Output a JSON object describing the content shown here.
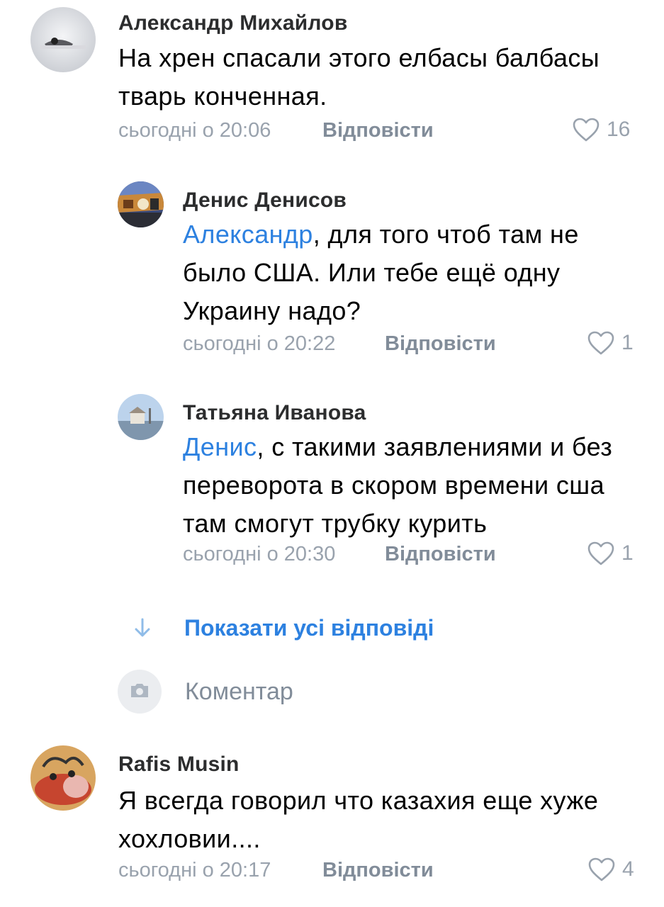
{
  "comments": [
    {
      "author": "Александр Михайлов",
      "text": "На хрен спасали этого елбасы балбасы тварь конченная.",
      "time": "сьогодні о 20:06",
      "reply_label": "Відповісти",
      "likes": "16"
    },
    {
      "author": "Денис Денисов",
      "mention": "Александр",
      "text": ", для того чтоб там не было США. Или тебе ещё одну Украину надо?",
      "time": "сьогодні о 20:22",
      "reply_label": "Відповісти",
      "likes": "1"
    },
    {
      "author": "Татьяна Иванова",
      "mention": "Денис",
      "text": ", с такими заявлениями и без переворота в скором времени сша там смогут трубку курить",
      "time": "сьогодні о 20:30",
      "reply_label": "Відповісти",
      "likes": "1"
    },
    {
      "author": "Rafis Musin",
      "text": "Я всегда говорил что казахия еще хуже хохловии....",
      "time": "сьогодні о 20:17",
      "reply_label": "Відповісти",
      "likes": "4"
    }
  ],
  "show_all_replies": "Показати усі відповіді",
  "comment_input": {
    "placeholder": "Коментар"
  },
  "icons": {
    "heart": "heart-icon",
    "arrow": "arrow-down-icon",
    "camera": "camera-icon"
  },
  "colors": {
    "link": "#2d81e0",
    "meta": "#99a2ad",
    "author": "#2c2d2e"
  }
}
